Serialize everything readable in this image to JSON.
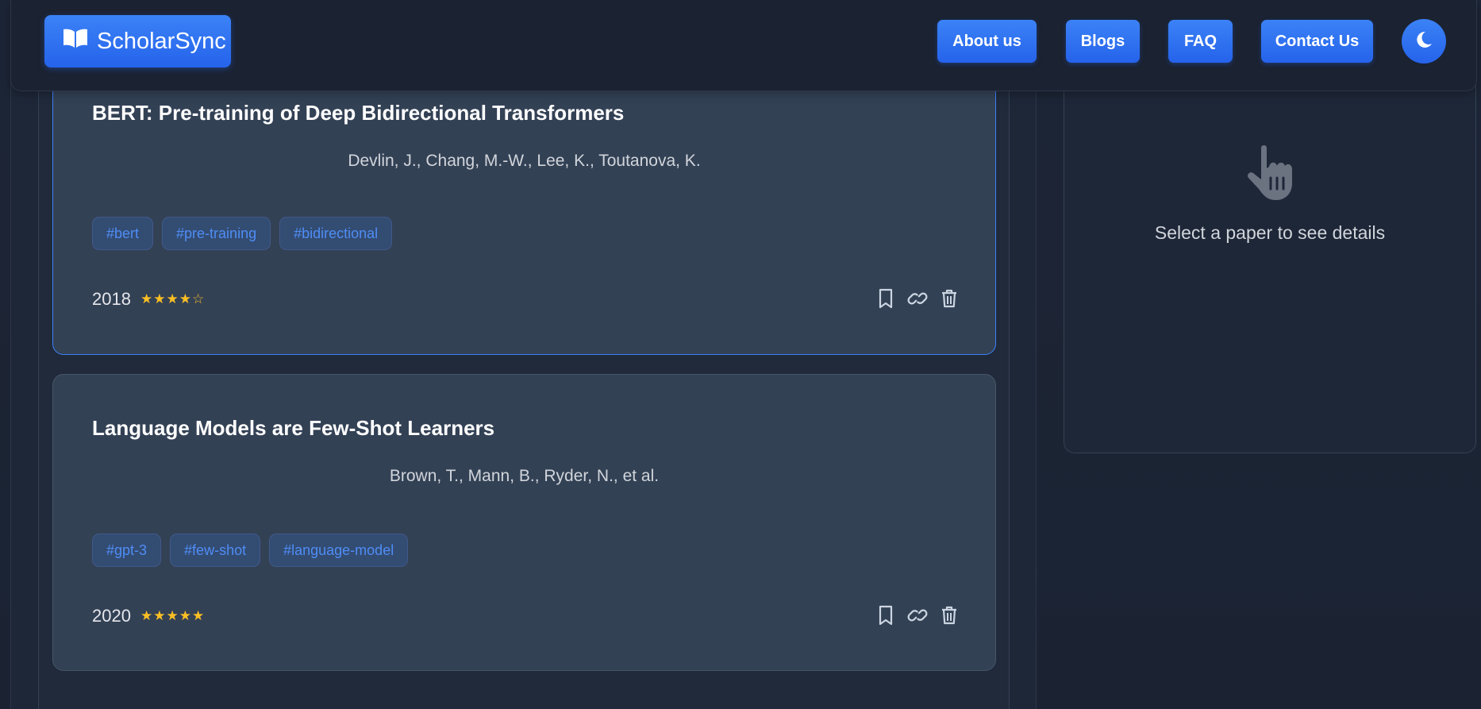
{
  "header": {
    "logo_text": "ScholarSync",
    "nav": {
      "about": "About us",
      "blogs": "Blogs",
      "faq": "FAQ",
      "contact": "Contact Us"
    }
  },
  "papers": [
    {
      "title": "BERT: Pre-training of Deep Bidirectional Transformers",
      "authors": "Devlin, J., Chang, M.-W., Lee, K., Toutanova, K.",
      "tags": [
        "#bert",
        "#pre-training",
        "#bidirectional"
      ],
      "year": "2018",
      "rating": 4,
      "rating_display": "★★★★☆",
      "selected": true
    },
    {
      "title": "Language Models are Few-Shot Learners",
      "authors": "Brown, T., Mann, B., Ryder, N., et al.",
      "tags": [
        "#gpt-3",
        "#few-shot",
        "#language-model"
      ],
      "year": "2020",
      "rating": 5,
      "rating_display": "★★★★★",
      "selected": false
    }
  ],
  "detail_panel": {
    "placeholder": "Select a paper to see details"
  },
  "colors": {
    "accent": "#3b82f6",
    "card_bg": "#334155",
    "star": "#fbbf24",
    "tag_text": "#4f8df5"
  },
  "icons": {
    "logo": "book-open-icon",
    "theme": "moon-icon",
    "bookmark": "bookmark-icon",
    "link": "link-icon",
    "delete": "trash-icon",
    "placeholder": "pointer-hand-icon"
  }
}
